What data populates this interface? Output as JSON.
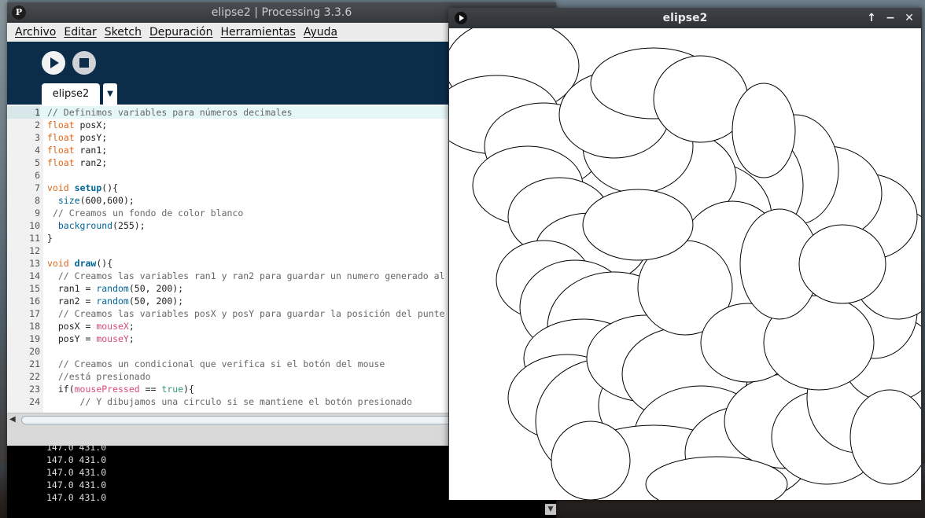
{
  "ide": {
    "title_name": "elipse2",
    "title_separator": " | ",
    "title_app": "Processing 3.3.6",
    "menu": [
      "Archivo",
      "Editar",
      "Sketch",
      "Depuración",
      "Herramientas",
      "Ayuda"
    ],
    "tab": "elipse2",
    "code": [
      "// Definimos variables para números decimales",
      "float posX;",
      "float posY;",
      "float ran1;",
      "float ran2;",
      "",
      "void setup(){",
      "  size(600,600);",
      " // Creamos un fondo de color blanco",
      "  background(255);",
      "}",
      "",
      "void draw(){",
      "  // Creamos las variables ran1 y ran2 para guardar un numero generado al",
      "  ran1 = random(50, 200);",
      "  ran2 = random(50, 200);",
      "  // Creamos las variables posX y posY para guardar la posición del punte",
      "  posX = mouseX;",
      "  posY = mouseY;",
      "",
      "  // Creamos un condicional que verifica si el botón del mouse",
      "  //está presionado",
      "  if(mousePressed == true){",
      "      // Y dibujamos una circulo si se mantiene el botón presionado"
    ],
    "console": [
      "147.0 431.0",
      "147.0 431.0",
      "147.0 431.0",
      "147.0 431.0",
      "147.0 431.0"
    ]
  },
  "sketch": {
    "title": "elipse2"
  },
  "icons": {
    "logo": "processing-logo-icon",
    "run": "play-icon",
    "stop": "stop-icon",
    "tab_menu": "chevron-down-icon",
    "maximize": "arrow-up-icon",
    "minimize": "minimize-icon",
    "close": "close-icon"
  },
  "colors": {
    "toolbar": "#0b2d4a",
    "comment": "#666666",
    "type": "#e2661a",
    "function": "#006699",
    "builtin": "#d94a7a",
    "keyword": "#33997e"
  }
}
